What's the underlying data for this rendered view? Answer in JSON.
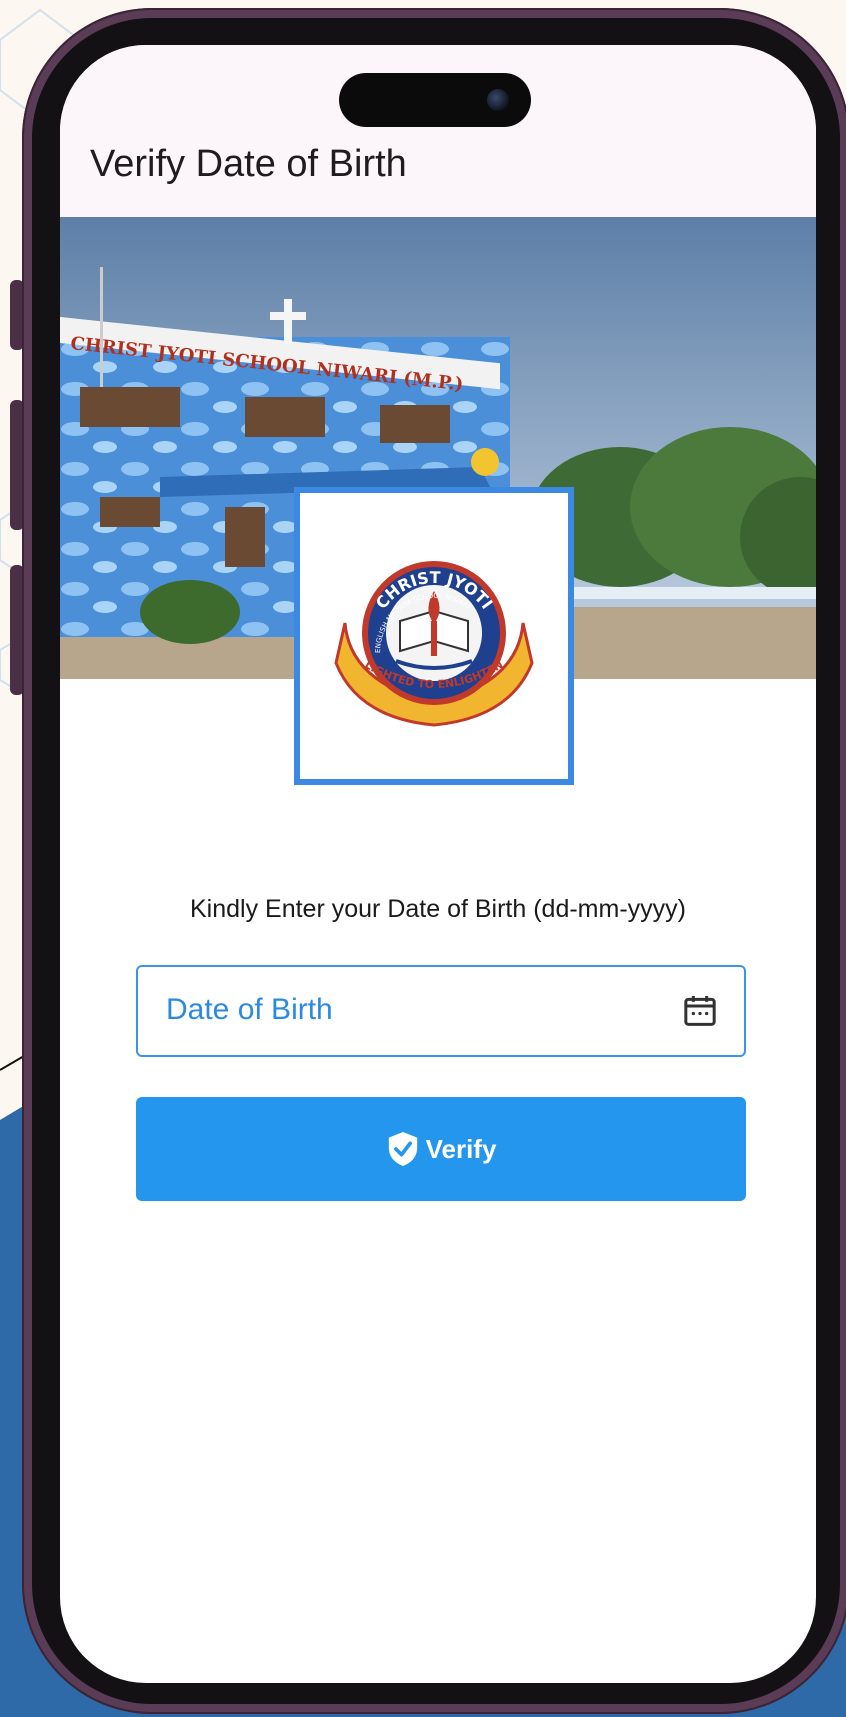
{
  "appbar": {
    "title": "Verify Date of Birth"
  },
  "banner": {
    "school_sign": "CHRIST JYOTI SCHOOL NIWARI (M.P.)"
  },
  "logo": {
    "top_text": "CHRIST JYOTI",
    "ring_text": "ENGLISH MEDIUM SCHOOL NIWARI",
    "motto": "LIGHTED TO ENLIGHTEN"
  },
  "form": {
    "instruction": "Kindly Enter your Date of Birth (dd-mm-yyyy)",
    "dob_label": "Date of Birth",
    "calendar_icon": "calendar-icon",
    "verify_label": "Verify",
    "verify_icon": "verified-shield-icon"
  },
  "colors": {
    "accent": "#2596ee",
    "field_border": "#3b95e6",
    "logo_card_border": "#3c89e4",
    "frame": "#5a3c56",
    "background": "#fdf7f1",
    "bg_blue": "#2e6aa8"
  }
}
